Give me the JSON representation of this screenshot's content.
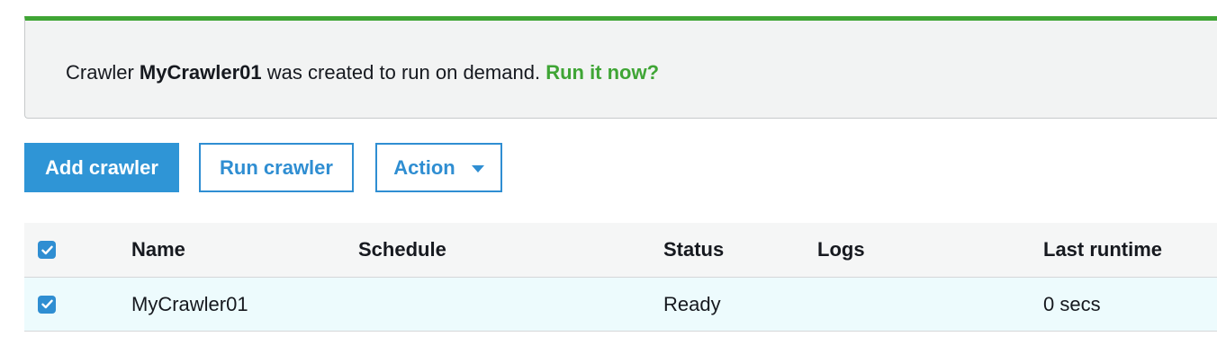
{
  "banner": {
    "prefix": "Crawler ",
    "crawler_name": "MyCrawler01",
    "suffix": " was created to run on demand. ",
    "run_link": "Run it now?"
  },
  "toolbar": {
    "add_label": "Add crawler",
    "run_label": "Run crawler",
    "action_label": "Action"
  },
  "table": {
    "headers": {
      "name": "Name",
      "schedule": "Schedule",
      "status": "Status",
      "logs": "Logs",
      "last_runtime": "Last runtime"
    },
    "select_all_checked": true,
    "rows": [
      {
        "checked": true,
        "name": "MyCrawler01",
        "schedule": "",
        "status": "Ready",
        "logs": "",
        "last_runtime": "0 secs"
      }
    ]
  },
  "colors": {
    "success_green": "#3fa535",
    "primary_blue": "#2f95d6",
    "link_blue": "#2f8ed2",
    "selected_row_bg": "#edfbfd"
  }
}
